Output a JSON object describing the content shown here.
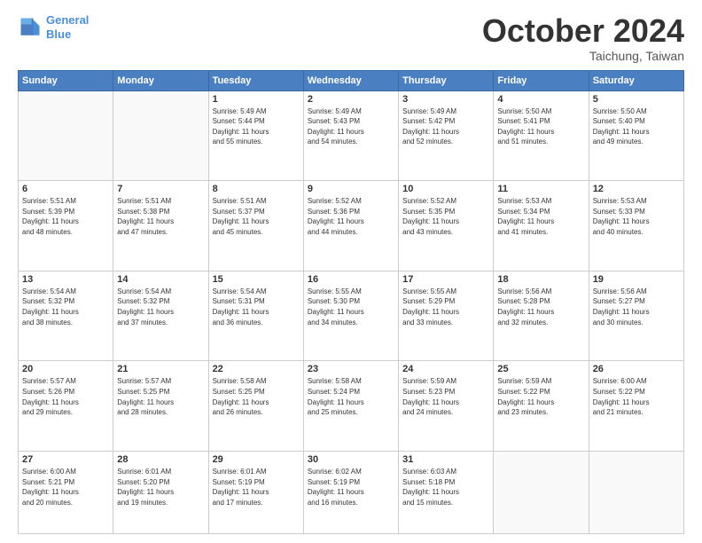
{
  "header": {
    "logo_line1": "General",
    "logo_line2": "Blue",
    "month": "October 2024",
    "location": "Taichung, Taiwan"
  },
  "weekdays": [
    "Sunday",
    "Monday",
    "Tuesday",
    "Wednesday",
    "Thursday",
    "Friday",
    "Saturday"
  ],
  "weeks": [
    [
      {
        "day": "",
        "info": ""
      },
      {
        "day": "",
        "info": ""
      },
      {
        "day": "1",
        "info": "Sunrise: 5:49 AM\nSunset: 5:44 PM\nDaylight: 11 hours\nand 55 minutes."
      },
      {
        "day": "2",
        "info": "Sunrise: 5:49 AM\nSunset: 5:43 PM\nDaylight: 11 hours\nand 54 minutes."
      },
      {
        "day": "3",
        "info": "Sunrise: 5:49 AM\nSunset: 5:42 PM\nDaylight: 11 hours\nand 52 minutes."
      },
      {
        "day": "4",
        "info": "Sunrise: 5:50 AM\nSunset: 5:41 PM\nDaylight: 11 hours\nand 51 minutes."
      },
      {
        "day": "5",
        "info": "Sunrise: 5:50 AM\nSunset: 5:40 PM\nDaylight: 11 hours\nand 49 minutes."
      }
    ],
    [
      {
        "day": "6",
        "info": "Sunrise: 5:51 AM\nSunset: 5:39 PM\nDaylight: 11 hours\nand 48 minutes."
      },
      {
        "day": "7",
        "info": "Sunrise: 5:51 AM\nSunset: 5:38 PM\nDaylight: 11 hours\nand 47 minutes."
      },
      {
        "day": "8",
        "info": "Sunrise: 5:51 AM\nSunset: 5:37 PM\nDaylight: 11 hours\nand 45 minutes."
      },
      {
        "day": "9",
        "info": "Sunrise: 5:52 AM\nSunset: 5:36 PM\nDaylight: 11 hours\nand 44 minutes."
      },
      {
        "day": "10",
        "info": "Sunrise: 5:52 AM\nSunset: 5:35 PM\nDaylight: 11 hours\nand 43 minutes."
      },
      {
        "day": "11",
        "info": "Sunrise: 5:53 AM\nSunset: 5:34 PM\nDaylight: 11 hours\nand 41 minutes."
      },
      {
        "day": "12",
        "info": "Sunrise: 5:53 AM\nSunset: 5:33 PM\nDaylight: 11 hours\nand 40 minutes."
      }
    ],
    [
      {
        "day": "13",
        "info": "Sunrise: 5:54 AM\nSunset: 5:32 PM\nDaylight: 11 hours\nand 38 minutes."
      },
      {
        "day": "14",
        "info": "Sunrise: 5:54 AM\nSunset: 5:32 PM\nDaylight: 11 hours\nand 37 minutes."
      },
      {
        "day": "15",
        "info": "Sunrise: 5:54 AM\nSunset: 5:31 PM\nDaylight: 11 hours\nand 36 minutes."
      },
      {
        "day": "16",
        "info": "Sunrise: 5:55 AM\nSunset: 5:30 PM\nDaylight: 11 hours\nand 34 minutes."
      },
      {
        "day": "17",
        "info": "Sunrise: 5:55 AM\nSunset: 5:29 PM\nDaylight: 11 hours\nand 33 minutes."
      },
      {
        "day": "18",
        "info": "Sunrise: 5:56 AM\nSunset: 5:28 PM\nDaylight: 11 hours\nand 32 minutes."
      },
      {
        "day": "19",
        "info": "Sunrise: 5:56 AM\nSunset: 5:27 PM\nDaylight: 11 hours\nand 30 minutes."
      }
    ],
    [
      {
        "day": "20",
        "info": "Sunrise: 5:57 AM\nSunset: 5:26 PM\nDaylight: 11 hours\nand 29 minutes."
      },
      {
        "day": "21",
        "info": "Sunrise: 5:57 AM\nSunset: 5:25 PM\nDaylight: 11 hours\nand 28 minutes."
      },
      {
        "day": "22",
        "info": "Sunrise: 5:58 AM\nSunset: 5:25 PM\nDaylight: 11 hours\nand 26 minutes."
      },
      {
        "day": "23",
        "info": "Sunrise: 5:58 AM\nSunset: 5:24 PM\nDaylight: 11 hours\nand 25 minutes."
      },
      {
        "day": "24",
        "info": "Sunrise: 5:59 AM\nSunset: 5:23 PM\nDaylight: 11 hours\nand 24 minutes."
      },
      {
        "day": "25",
        "info": "Sunrise: 5:59 AM\nSunset: 5:22 PM\nDaylight: 11 hours\nand 23 minutes."
      },
      {
        "day": "26",
        "info": "Sunrise: 6:00 AM\nSunset: 5:22 PM\nDaylight: 11 hours\nand 21 minutes."
      }
    ],
    [
      {
        "day": "27",
        "info": "Sunrise: 6:00 AM\nSunset: 5:21 PM\nDaylight: 11 hours\nand 20 minutes."
      },
      {
        "day": "28",
        "info": "Sunrise: 6:01 AM\nSunset: 5:20 PM\nDaylight: 11 hours\nand 19 minutes."
      },
      {
        "day": "29",
        "info": "Sunrise: 6:01 AM\nSunset: 5:19 PM\nDaylight: 11 hours\nand 17 minutes."
      },
      {
        "day": "30",
        "info": "Sunrise: 6:02 AM\nSunset: 5:19 PM\nDaylight: 11 hours\nand 16 minutes."
      },
      {
        "day": "31",
        "info": "Sunrise: 6:03 AM\nSunset: 5:18 PM\nDaylight: 11 hours\nand 15 minutes."
      },
      {
        "day": "",
        "info": ""
      },
      {
        "day": "",
        "info": ""
      }
    ]
  ]
}
